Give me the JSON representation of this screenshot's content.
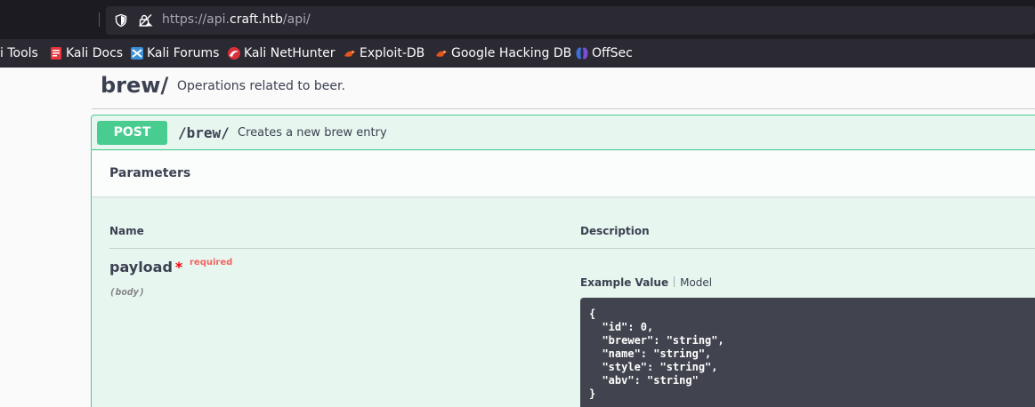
{
  "browser": {
    "url_prefix": "https://api.",
    "url_host": "craft.htb",
    "url_suffix": "/api/",
    "bookmarks": [
      {
        "label": "i Tools",
        "icon": "none"
      },
      {
        "label": "Kali Docs",
        "icon": "kali-docs-icon"
      },
      {
        "label": "Kali Forums",
        "icon": "kali-forums-icon"
      },
      {
        "label": "Kali NetHunter",
        "icon": "kali-nethunter-icon"
      },
      {
        "label": "Exploit-DB",
        "icon": "exploit-db-icon"
      },
      {
        "label": "Google Hacking DB",
        "icon": "ghdb-icon"
      },
      {
        "label": "OffSec",
        "icon": "offsec-icon"
      }
    ]
  },
  "tag": {
    "name": "brew/",
    "description": "Operations related to beer."
  },
  "operation": {
    "method": "POST",
    "path": "/brew/",
    "summary": "Creates a new brew entry",
    "method_color": "#49cc90"
  },
  "parameters": {
    "title": "Parameters",
    "col_name": "Name",
    "col_description": "Description",
    "items": [
      {
        "name": "payload",
        "required_mark": "*",
        "required_label": "required",
        "in": "(body)",
        "tab_example": "Example Value",
        "tab_model": "Model",
        "example": "{\n  \"id\": 0,\n  \"brewer\": \"string\",\n  \"name\": \"string\",\n  \"style\": \"string\",\n  \"abv\": \"string\"\n}"
      }
    ]
  }
}
